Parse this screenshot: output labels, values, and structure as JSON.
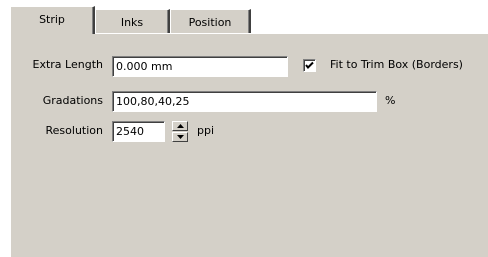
{
  "tabs": [
    {
      "label": "Strip",
      "active": true
    },
    {
      "label": "Inks",
      "active": false
    },
    {
      "label": "Position",
      "active": false
    }
  ],
  "extra_length": {
    "label": "Extra Length",
    "value": "0.000 mm"
  },
  "fit_to_trim": {
    "label": "Fit to Trim Box (Borders)",
    "checked": true
  },
  "gradations": {
    "label": "Gradations",
    "value": "100,80,40,25",
    "unit": "%"
  },
  "resolution": {
    "label": "Resolution",
    "value": "2540",
    "unit": "ppi"
  }
}
